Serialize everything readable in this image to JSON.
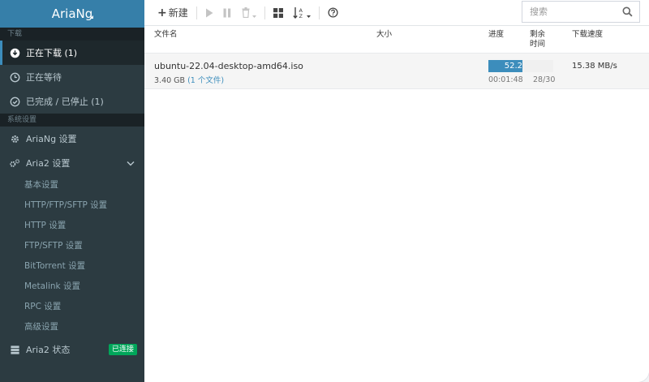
{
  "sidebar": {
    "brand": "AriaNg",
    "section_download": "下载",
    "downloading": "正在下载 (1)",
    "waiting": "正在等待",
    "stopped": "已完成 / 已停止 (1)",
    "section_settings": "系统设置",
    "ariang_settings": "AriaNg 设置",
    "aria2_settings": "Aria2 设置",
    "submenu": [
      "基本设置",
      "HTTP/FTP/SFTP 设置",
      "HTTP 设置",
      "FTP/SFTP 设置",
      "BitTorrent 设置",
      "Metalink 设置",
      "RPC 设置",
      "高级设置"
    ],
    "aria2_status": "Aria2 状态",
    "status_badge": "已连接"
  },
  "toolbar": {
    "new_label": "新建",
    "search_placeholder": "搜索"
  },
  "table": {
    "col_name": "文件名",
    "col_size": "大小",
    "col_progress": "进度",
    "col_remaining_1": "剩余",
    "col_remaining_2": "时间",
    "col_speed": "下载速度"
  },
  "task": {
    "name": "ubuntu-22.04-desktop-amd64.iso",
    "size": "3.40 GB",
    "file_count": "(1 个文件)",
    "progress_text": "52.2",
    "progress_fraction": 0.52,
    "remaining_time": "00:01:48",
    "connections": "28/30",
    "speed": "15.38 MB/s"
  },
  "colors": {
    "accent": "#3c8dbc",
    "sidebar_bg": "#2c3b41",
    "status_ok": "#00a65a"
  }
}
